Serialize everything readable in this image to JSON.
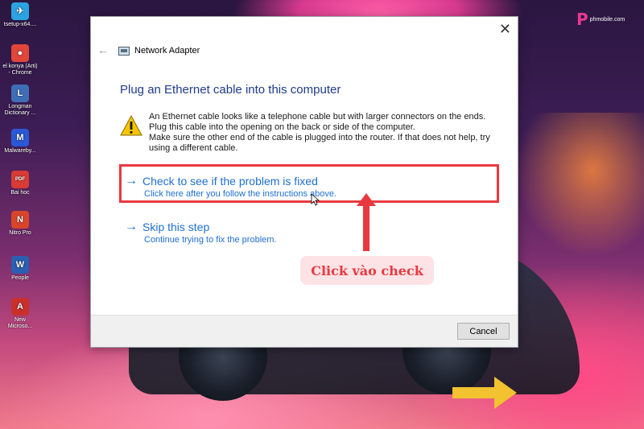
{
  "desktop": {
    "icons": [
      {
        "label": "tsetup-x64....",
        "color": "#2aa3e0",
        "glyph": "✈",
        "icon": "telegram-icon"
      },
      {
        "label": "el konya (Arti) - Chrome",
        "color": "#e0463a",
        "glyph": "●",
        "icon": "chrome-icon"
      },
      {
        "label": "Longman Dictionary ...",
        "color": "#3e6fb6",
        "glyph": "L",
        "icon": "longman-icon"
      },
      {
        "label": "Malwareby...",
        "color": "#2a58d6",
        "glyph": "M",
        "icon": "malwarebytes-icon"
      },
      {
        "label": "Bai hoc",
        "color": "#d83b35",
        "glyph": "PDF",
        "icon": "pdf-icon"
      },
      {
        "label": "Nitro Pro",
        "color": "#d8452a",
        "glyph": "N",
        "icon": "nitro-icon"
      },
      {
        "label": "People",
        "color": "#2b5fb3",
        "glyph": "W",
        "icon": "word-icon"
      },
      {
        "label": "New Microso...",
        "color": "#c9302c",
        "glyph": "A",
        "icon": "access-icon"
      }
    ],
    "logo_text": "phmobile.com"
  },
  "dialog": {
    "window_title": "Network Adapter",
    "close_glyph": "✕",
    "back_glyph": "←",
    "heading": "Plug an Ethernet cable into this computer",
    "warning_lines": [
      "An Ethernet cable looks like a telephone cable but with larger connectors on the ends.",
      "Plug this cable into the opening on the back or side of the computer.",
      "Make sure the other end of the cable is plugged into the router. If that does not help, try",
      "using a different cable."
    ],
    "option_check": {
      "arrow": "→",
      "title": "Check to see if the problem is fixed",
      "subtitle": "Click here after you follow the instructions above."
    },
    "option_skip": {
      "arrow": "→",
      "title": "Skip this step",
      "subtitle": "Continue trying to fix the problem."
    },
    "cancel_label": "Cancel"
  },
  "annotation": {
    "callout_text": "Click vào check",
    "highlight_color": "#e8393f",
    "arrow_color": "#f2c230"
  }
}
